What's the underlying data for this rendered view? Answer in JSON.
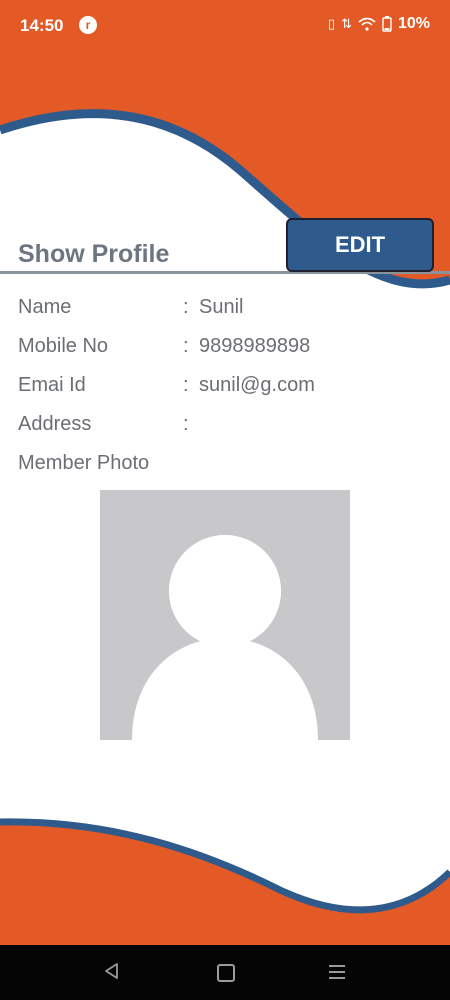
{
  "status_bar": {
    "time": "14:50",
    "app_icon_glyph": "r",
    "battery": "10%",
    "icons": [
      "vibrate-icon",
      "data-arrows-icon",
      "wifi-icon",
      "battery-icon"
    ]
  },
  "page": {
    "title": "Show Profile",
    "edit_label": "EDIT"
  },
  "profile": {
    "fields": [
      {
        "label": "Name",
        "colon": ":",
        "value": "Sunil"
      },
      {
        "label": "Mobile No",
        "colon": ":",
        "value": "9898989898"
      },
      {
        "label": "Emai Id",
        "colon": ":",
        "value": "sunil@g.com"
      },
      {
        "label": "Address",
        "colon": ":",
        "value": ""
      },
      {
        "label": "Member Photo",
        "colon": "",
        "value": ""
      }
    ]
  },
  "colors": {
    "accent": "#e45a26",
    "wave_blue": "#2f5a8c",
    "photo_bg": "#c8c7ca"
  }
}
